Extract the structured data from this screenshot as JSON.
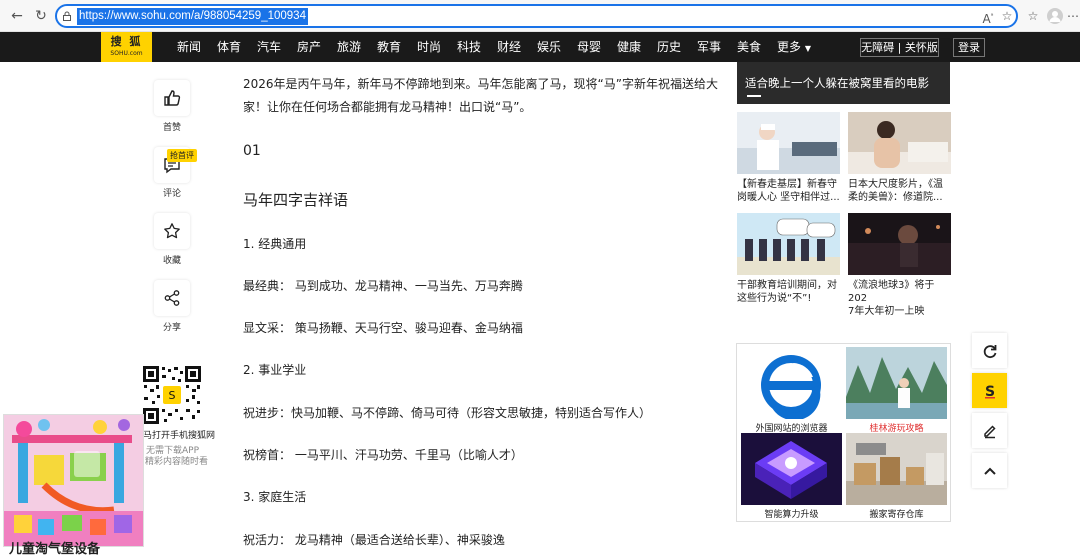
{
  "browser": {
    "url": "https://www.sohu.com/a/988054259_100934"
  },
  "nav": {
    "logo_top": "搜 狐",
    "logo_bottom": "SOHU.com",
    "links": [
      "新闻",
      "体育",
      "汽车",
      "房产",
      "旅游",
      "教育",
      "时尚",
      "科技",
      "财经",
      "娱乐",
      "母婴",
      "健康",
      "历史",
      "军事",
      "美食",
      "更多"
    ],
    "barrier_free": "无障碍 | 关怀版",
    "login": "登录"
  },
  "actions": {
    "like": "首赞",
    "comment": "评论",
    "comment_badge": "抢首评",
    "favorite": "收藏",
    "share": "分享"
  },
  "qr": {
    "line1": "马打开手机搜狐网",
    "line2": "无需下载APP",
    "line3": "精彩内容随时看"
  },
  "left_ad": {
    "caption": "儿童淘气堡设备"
  },
  "article": {
    "intro_1": "2026年是丙午马年，新年马不停蹄地到来。马年怎能离了马，现将“马”字新年祝福送给大",
    "intro_2": "家！让你在任何场合都能拥有龙马精神！出口说“马”。",
    "section_no": "01",
    "section_title": "马年四字吉祥语",
    "sub1": "1. 经典通用",
    "classic": "最经典：  马到成功、龙马精神、一马当先、万马奔腾",
    "literary": "显文采：  策马扬鞭、天马行空、骏马迎春、金马纳福",
    "sub2": "2. 事业学业",
    "progress": "祝进步：快马加鞭、马不停蹄、倚马可待（形容文思敏捷，特别适合写作人）",
    "ranking": "祝榜首：  一马平川、汗马功劳、千里马（比喻人才）",
    "sub3": "3. 家庭生活",
    "vitality": "祝活力：  龙马精神（最适合送给长辈）、神采骏逸"
  },
  "sidebar": {
    "banner": "适合晚上一个人躲在被窝里看的电影",
    "news": [
      {
        "line1": "【新春走基层】新春守",
        "line2": "岗暖人心 坚守相伴过..."
      },
      {
        "line1": "日本大尺度影片，《温",
        "line2": "柔的美兽》：修道院..."
      },
      {
        "line1": "干部教育培训期间，对",
        "line2": "这些行为说“不”!"
      },
      {
        "line1": "《流浪地球3》将于202",
        "line2": "7年大年初一上映"
      }
    ],
    "ads": [
      "外国网站的浏览器",
      "桂林游玩攻略",
      "智能算力升级",
      "搬家寄存仓库"
    ],
    "ad_colors": {
      "accent_red": "#e03030"
    }
  },
  "tools": {
    "refresh": "refresh-icon",
    "sohu": "sohu-icon",
    "edit": "edit-icon",
    "top": "back-to-top-icon"
  }
}
